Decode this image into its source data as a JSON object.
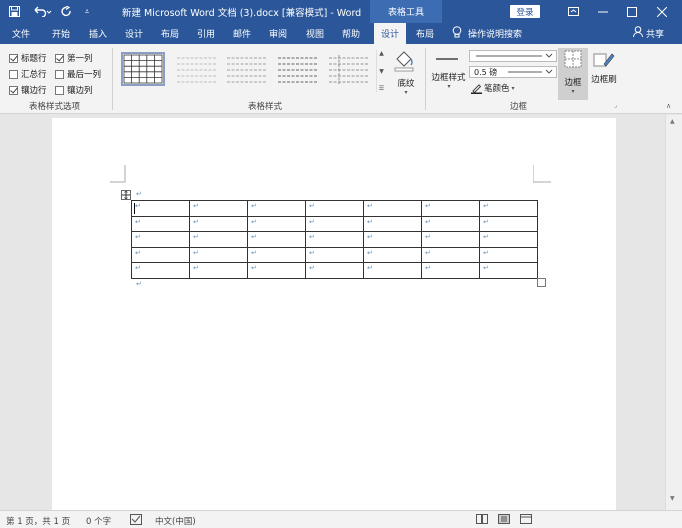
{
  "title_bar": {
    "document_title": "新建 Microsoft Word 文档 (3).docx [兼容模式]  -  Word",
    "context_banner": "表格工具",
    "login_label": "登录",
    "quick_access": {
      "save_icon": "save-icon",
      "undo_icon": "undo-icon",
      "redo_icon": "redo-icon",
      "customize_icon": "customize-quick-access-icon"
    },
    "window_controls": {
      "ribbon_display_icon": "ribbon-display-options-icon",
      "minimize_icon": "minimize-icon",
      "maximize_icon": "maximize-icon",
      "close_icon": "close-icon"
    }
  },
  "tabs": {
    "file": "文件",
    "home": "开始",
    "insert": "插入",
    "design": "设计",
    "layout": "布局",
    "references": "引用",
    "mailings": "邮件",
    "review": "审阅",
    "view": "视图",
    "help": "帮助",
    "table_design": "设计",
    "table_layout": "布局",
    "tell_me": "操作说明搜索",
    "share": "共享"
  },
  "ribbon": {
    "style_options": {
      "header_row": "标题行",
      "first_column": "第一列",
      "total_row": "汇总行",
      "last_column": "最后一列",
      "banded_rows": "镶边行",
      "banded_columns": "镶边列",
      "group_label": "表格样式选项"
    },
    "table_styles": {
      "group_label": "表格样式",
      "shading_label": "底纹"
    },
    "borders": {
      "border_styles_label": "边框样式",
      "line_weight": "0.5 磅",
      "pen_color_label": "笔颜色",
      "borders_label": "边框",
      "border_painter_label": "边框刷",
      "group_label": "边框"
    }
  },
  "document": {
    "table_rows": 5,
    "table_cols": 7,
    "cell_mark": "↵",
    "paragraph_mark": "↵"
  },
  "status_bar": {
    "page_info": "第 1 页，共 1 页",
    "word_count": "0 个字",
    "language": "中文(中国)"
  },
  "colors": {
    "title_bar": "#2b579a",
    "ribbon_bg": "#f3f3f3",
    "page_bg": "#ffffff",
    "workspace_bg": "#e6e6e6"
  }
}
